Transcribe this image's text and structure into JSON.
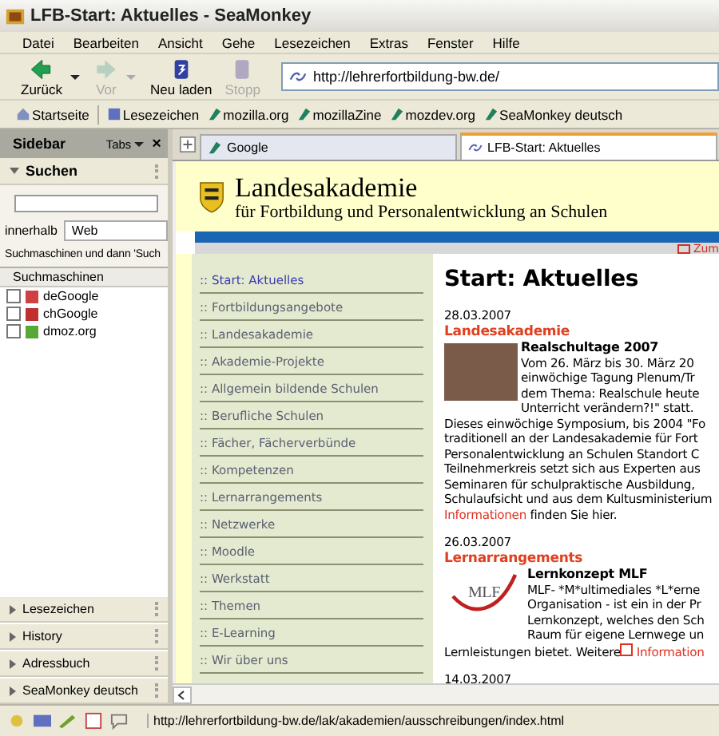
{
  "window": {
    "title": "LFB-Start: Aktuelles - SeaMonkey"
  },
  "menu": [
    "Datei",
    "Bearbeiten",
    "Ansicht",
    "Gehe",
    "Lesezeichen",
    "Extras",
    "Fenster",
    "Hilfe"
  ],
  "nav_buttons": [
    {
      "kind": "back",
      "label": "Zurück",
      "disabled": false
    },
    {
      "kind": "forward",
      "label": "Vor",
      "disabled": true
    },
    {
      "kind": "reload",
      "label": "Neu laden",
      "disabled": false
    },
    {
      "kind": "stop",
      "label": "Stopp",
      "disabled": true
    }
  ],
  "address": {
    "value": "http://lehrerfortbildung-bw.de/"
  },
  "bookmarks": [
    {
      "kind": "home",
      "label": "Startseite"
    },
    {
      "kind": "folder",
      "label": "Lesezeichen"
    },
    {
      "kind": "link",
      "label": "mozilla.org"
    },
    {
      "kind": "link",
      "label": "mozillaZine"
    },
    {
      "kind": "link",
      "label": "mozdev.org"
    },
    {
      "kind": "link",
      "label": "SeaMonkey deutsch"
    }
  ],
  "sidebar": {
    "title": "Sidebar",
    "tabs_label": "Tabs",
    "close": "×",
    "search_panel": {
      "title": "Suchen",
      "expanded": true,
      "scope_label": "innerhalb",
      "scope": "Web",
      "hint": "Suchmaschinen und dann 'Such",
      "list_header": "Suchmaschinen",
      "engines": [
        {
          "label": "deGoogle",
          "checked": false,
          "color": "#d04040"
        },
        {
          "label": "chGoogle",
          "checked": false,
          "color": "#c03030"
        },
        {
          "label": "dmoz.org",
          "checked": false,
          "color": "#58a838"
        }
      ]
    },
    "panels": [
      {
        "label": "Lesezeichen",
        "expanded": false
      },
      {
        "label": "History",
        "expanded": false
      },
      {
        "label": "Adressbuch",
        "expanded": false
      },
      {
        "label": "SeaMonkey deutsch",
        "expanded": false
      }
    ]
  },
  "tabs": [
    {
      "label": "Google",
      "kind": "link",
      "selected": false
    },
    {
      "label": "LFB-Start: Aktuelles",
      "kind": "page",
      "selected": true
    }
  ],
  "page": {
    "title": "Landesakademie",
    "subtitle": "für Fortbildung und Personalentwicklung an Schulen",
    "top_link": "Zum",
    "nav": [
      {
        "label": ":: Start: Aktuelles",
        "selected": true
      },
      {
        "label": ":: Fortbildungsangebote",
        "selected": false
      },
      {
        "label": ":: Landesakademie",
        "selected": false
      },
      {
        "label": ":: Akademie-Projekte",
        "selected": false
      },
      {
        "label": ":: Allgemein bildende Schulen",
        "selected": false
      },
      {
        "label": ":: Berufliche Schulen",
        "selected": false
      },
      {
        "label": ":: Fächer, Fächerverbünde",
        "selected": false
      },
      {
        "label": ":: Kompetenzen",
        "selected": false
      },
      {
        "label": ":: Lernarrangements",
        "selected": false
      },
      {
        "label": ":: Netzwerke",
        "selected": false
      },
      {
        "label": ":: Moodle",
        "selected": false
      },
      {
        "label": ":: Werkstatt",
        "selected": false
      },
      {
        "label": ":: Themen",
        "selected": false
      },
      {
        "label": ":: E-Learning",
        "selected": false
      },
      {
        "label": ":: Wir über uns",
        "selected": false
      }
    ],
    "heading": "Start: Aktuelles",
    "news": [
      {
        "date": "28.03.2007",
        "category": "Landesakademie",
        "image": {
          "kind": "photo"
        },
        "title": "Realschultage 2007",
        "side_lines": [
          "Vom 26. März bis 30. März 20",
          "einwöchige Tagung Plenum/Tr",
          "dem Thema: Realschule heute",
          "Unterricht verändern?!\" statt."
        ],
        "lines": [
          "Dieses einwöchige Symposium, bis 2004 \"Fo",
          "traditionell an der Landesakademie für Fort",
          "Personalentwicklung an Schulen Standort C",
          "Teilnehmerkreis setzt sich aus Experten aus",
          "Seminaren für schulpraktische Ausbildung,",
          "Schulaufsicht und aus dem Kultusministerium"
        ],
        "tail": {
          "link": "Informationen",
          "after": " finden Sie hier.",
          "link_icon": false
        }
      },
      {
        "date": "26.03.2007",
        "category": "Lernarrangements",
        "image": {
          "kind": "logo",
          "text": "MLF"
        },
        "title": "Lernkonzept MLF",
        "side_lines": [
          "MLF- *M*ultimediales *L*erne",
          "Organisation - ist ein in der Pr",
          "Lernkonzept, welches den Sch",
          "Raum für eigene Lernwege un"
        ],
        "tail": {
          "before": "Lernleistungen bietet. Weitere",
          "link": "Information",
          "link_icon": true
        }
      },
      {
        "date": "14.03.2007"
      }
    ]
  },
  "status_bar": {
    "url": "http://lehrerfortbildung-bw.de/lak/akademien/ausschreibungen/index.html"
  }
}
